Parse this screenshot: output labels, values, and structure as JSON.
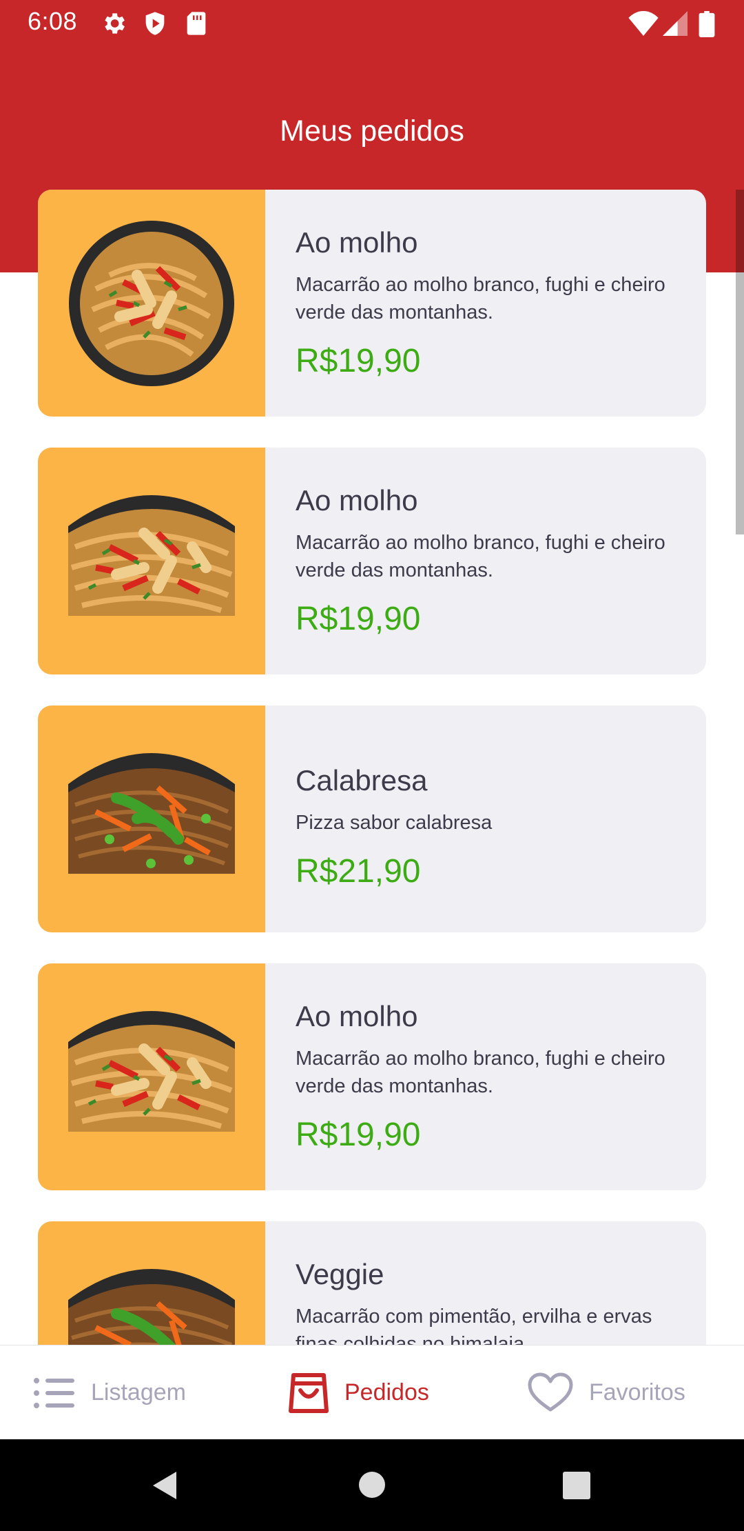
{
  "status_bar": {
    "time": "6:08",
    "icons": [
      "gear-icon",
      "shield-icon",
      "sd-card-icon",
      "wifi-icon",
      "signal-icon",
      "battery-icon"
    ]
  },
  "header": {
    "title": "Meus pedidos"
  },
  "orders": [
    {
      "name": "Ao molho",
      "description": "Macarrão ao molho branco, fughi e cheiro verde das montanhas.",
      "price": "R$19,90"
    },
    {
      "name": "Ao molho",
      "description": "Macarrão ao molho branco, fughi e cheiro verde das montanhas.",
      "price": "R$19,90"
    },
    {
      "name": "Calabresa",
      "description": "Pizza sabor calabresa",
      "price": "R$21,90"
    },
    {
      "name": "Ao molho",
      "description": "Macarrão ao molho branco, fughi e cheiro verde das montanhas.",
      "price": "R$19,90"
    },
    {
      "name": "Veggie",
      "description": "Macarrão com pimentão, ervilha e ervas finas colhidas no himalaia",
      "price": ""
    }
  ],
  "bottom_nav": {
    "items": [
      {
        "label": "Listagem",
        "icon": "list-icon"
      },
      {
        "label": "Pedidos",
        "icon": "shopping-bag-icon"
      },
      {
        "label": "Favoritos",
        "icon": "heart-icon"
      }
    ],
    "active": "Pedidos"
  },
  "colors": {
    "header_red": "#c8272a",
    "thumb_orange": "#fdb446",
    "card_bg": "#efeff4",
    "price_green": "#3dac14",
    "nav_inactive": "#a6a4b8"
  }
}
